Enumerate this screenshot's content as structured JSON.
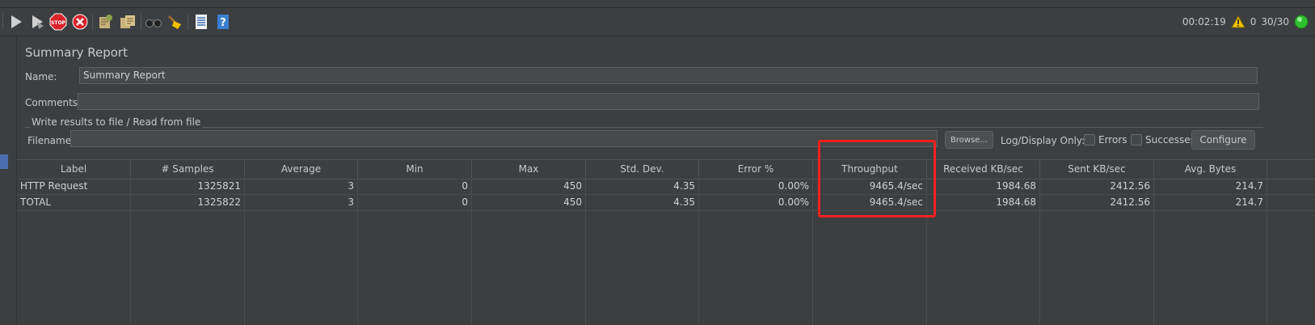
{
  "status": {
    "elapsed": "00:02:19",
    "warnings": "0",
    "threads": "30/30"
  },
  "panel": {
    "title": "Summary Report",
    "name_label": "Name:",
    "name_value": "Summary Report",
    "comments_label": "Comments:",
    "comments_value": "",
    "group_title": "Write results to file / Read from file",
    "filename_label": "Filename",
    "filename_value": "",
    "browse_label": "Browse...",
    "log_display_label": "Log/Display Only:",
    "errors_label": "Errors",
    "successes_label": "Successes",
    "configure_label": "Configure"
  },
  "table": {
    "headers": [
      "Label",
      "# Samples",
      "Average",
      "Min",
      "Max",
      "Std. Dev.",
      "Error %",
      "Throughput",
      "Received KB/sec",
      "Sent KB/sec",
      "Avg. Bytes"
    ],
    "rows": [
      [
        "HTTP Request",
        "1325821",
        "3",
        "0",
        "450",
        "4.35",
        "0.00%",
        "9465.4/sec",
        "1984.68",
        "2412.56",
        "214.7"
      ],
      [
        "TOTAL",
        "1325822",
        "3",
        "0",
        "450",
        "4.35",
        "0.00%",
        "9465.4/sec",
        "1984.68",
        "2412.56",
        "214.7"
      ]
    ]
  },
  "colors": {
    "highlight": "#ff1f1f",
    "status_ok": "#2fbf2f",
    "warning": "#f2c200"
  },
  "icons": [
    "start-icon",
    "start-no-pauses-icon",
    "stop-icon",
    "shutdown-icon",
    "clear-icon",
    "clear-all-icon",
    "search-icon",
    "reset-search-icon",
    "function-helper-icon",
    "help-icon",
    "warning-icon",
    "status-ok-icon"
  ]
}
